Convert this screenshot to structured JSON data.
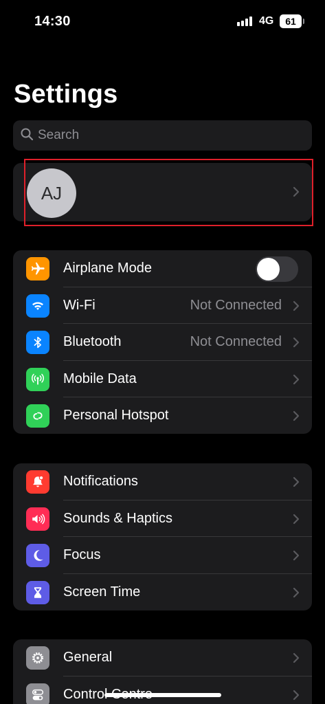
{
  "status_bar": {
    "time": "14:30",
    "network": "4G",
    "battery": "61"
  },
  "page_title": "Settings",
  "search": {
    "placeholder": "Search"
  },
  "profile": {
    "initials": "AJ"
  },
  "groups": [
    {
      "rows": [
        {
          "label": "Airplane Mode",
          "icon": "airplane-icon",
          "color": "#ff9500",
          "toggle": "off"
        },
        {
          "label": "Wi-Fi",
          "value": "Not Connected",
          "icon": "wifi-icon",
          "color": "#0a84ff"
        },
        {
          "label": "Bluetooth",
          "value": "Not Connected",
          "icon": "bluetooth-icon",
          "color": "#0a84ff"
        },
        {
          "label": "Mobile Data",
          "icon": "antenna-icon",
          "color": "#30d158"
        },
        {
          "label": "Personal Hotspot",
          "icon": "hotspot-icon",
          "color": "#30d158"
        }
      ]
    },
    {
      "rows": [
        {
          "label": "Notifications",
          "icon": "bell-icon",
          "color": "#ff3b30"
        },
        {
          "label": "Sounds & Haptics",
          "icon": "speaker-icon",
          "color": "#ff2d55"
        },
        {
          "label": "Focus",
          "icon": "moon-icon",
          "color": "#5e5ce6"
        },
        {
          "label": "Screen Time",
          "icon": "hourglass-icon",
          "color": "#5e5ce6"
        }
      ]
    },
    {
      "rows": [
        {
          "label": "General",
          "icon": "gear-icon",
          "color": "#8e8e93"
        },
        {
          "label": "Control Centre",
          "icon": "toggles-icon",
          "color": "#8e8e93"
        }
      ]
    }
  ]
}
